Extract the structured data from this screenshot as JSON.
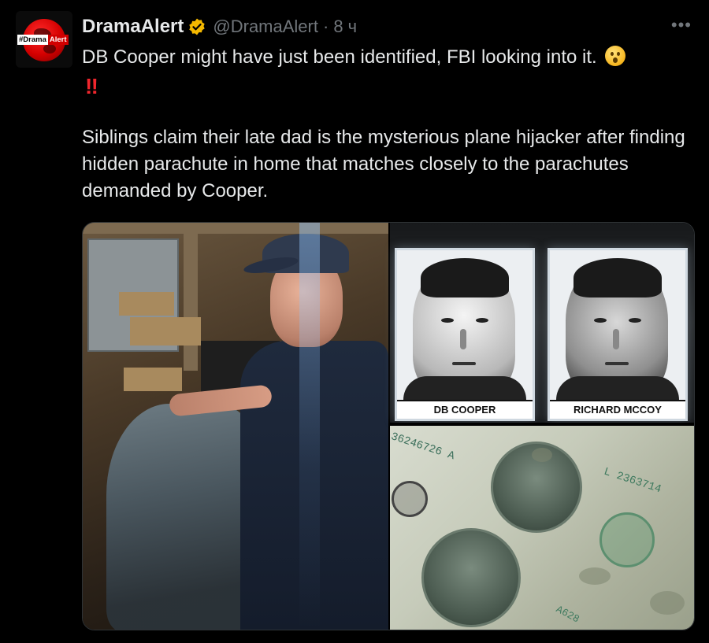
{
  "post": {
    "author": {
      "name": "DramaAlert",
      "handle": "@DramaAlert",
      "avatar_badge": [
        "#Drama",
        "Alert"
      ],
      "verified_badge_color": "#f4b800"
    },
    "separator": "·",
    "time_ago": "8 ч",
    "more_icon": "•••",
    "text_line1": "DB Cooper might have just been identified, FBI looking into it.",
    "emoji_1": "astonished-face-emoji",
    "emoji_2_text": "‼",
    "paragraph2": "Siblings claim their late dad is the mysterious plane hijacker after finding hidden parachute in home that matches closely to the parachutes demanded by Cooper."
  },
  "media": {
    "mugshot_left_label": "DB COOPER",
    "mugshot_right_label": "RICHARD MCCOY",
    "bill_serial_1": "36246726 A",
    "bill_serial_2": "L 2363714",
    "bill_serial_3": "A628"
  },
  "colors": {
    "background": "#000000",
    "text": "#e7e9ea",
    "muted": "#71767b",
    "red_emoji": "#f0262d"
  }
}
